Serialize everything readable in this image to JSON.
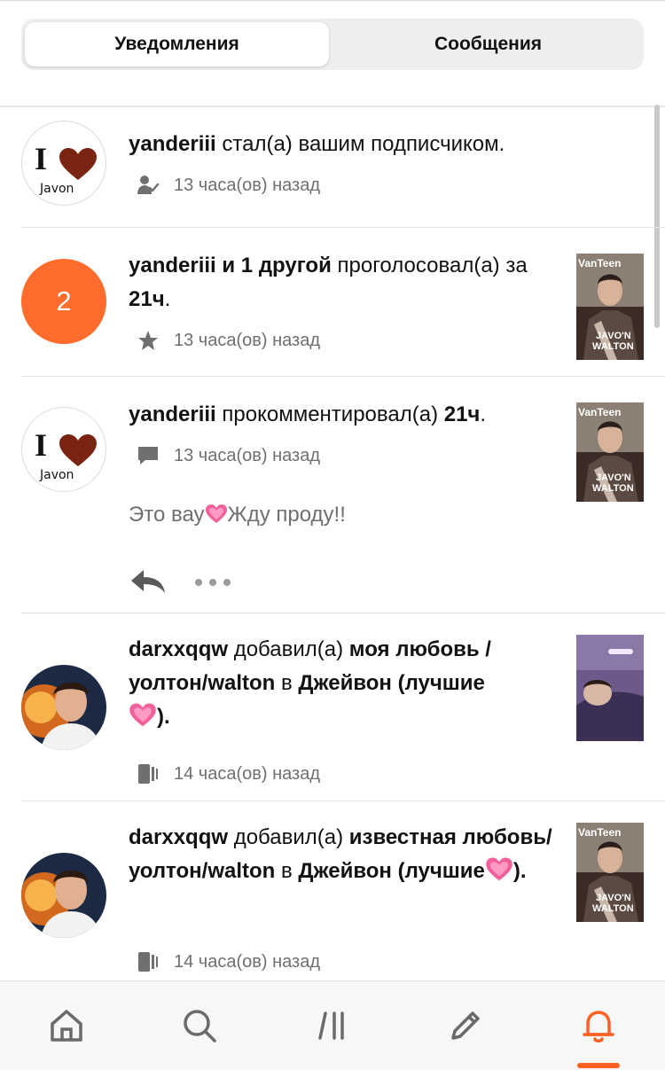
{
  "tabs": {
    "notifications": "Уведомления",
    "messages": "Сообщения"
  },
  "avatar_javon": {
    "letter": "I",
    "word": "Javon"
  },
  "items": [
    {
      "user": "yanderiii",
      "action": " стал(а) вашим подписчиком.",
      "time": "13 часа(ов) назад",
      "icon": "follow-icon"
    },
    {
      "user": "yanderiii и 1 другой",
      "action": " проголосовал(а) за ",
      "target": "21ч",
      "suffix": ".",
      "time": "13 часа(ов) назад",
      "icon": "star-icon",
      "count": "2"
    },
    {
      "user": "yanderiii",
      "action": " прокомментировал(а) ",
      "target": "21ч",
      "suffix": ".",
      "time": "13 часа(ов) назад",
      "icon": "comment-icon",
      "comment_before": "Это вау",
      "comment_after": "Жду проду!!"
    },
    {
      "user": "darxxqqw",
      "action": " добавил(а) ",
      "story": "моя любовь / уолтон/walton",
      "in": " в ",
      "list": "Джейвон (лучшие",
      "list_close": ").",
      "time": "14 часа(ов) назад",
      "icon": "reading-list-icon"
    },
    {
      "user": "darxxqqw",
      "action": " добавил(а)  ",
      "story": "известная любовь/уолтон/walton",
      "in": " в ",
      "list": "Джейвон (лучшие",
      "list_close": ").",
      "time": "14 часа(ов) назад",
      "icon": "reading-list-icon"
    }
  ],
  "thumb_cover": {
    "brand": "VanTeen",
    "line1": "JAVO'N",
    "line2": "WALTON"
  },
  "colors": {
    "accent": "#ff6122",
    "avatar_count_bg": "#ff6c2b",
    "meta_text": "#6f6f6f"
  }
}
